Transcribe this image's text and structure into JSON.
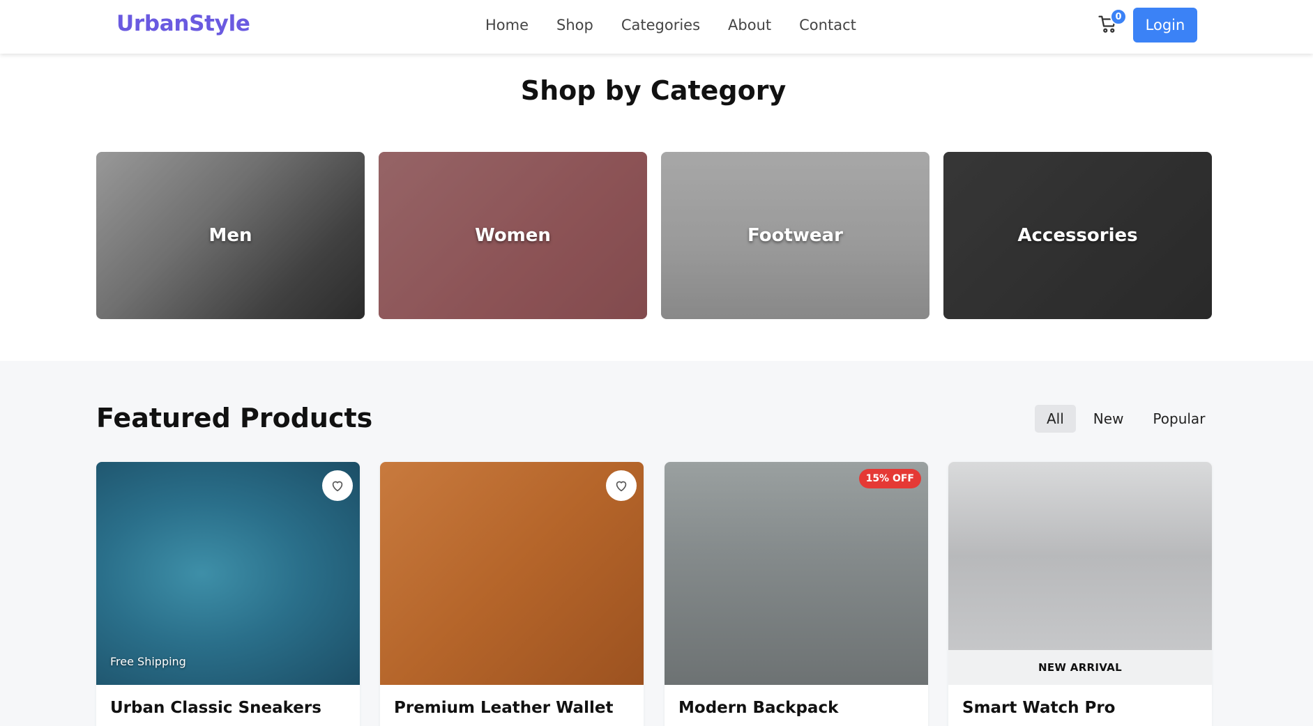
{
  "header": {
    "logo": "UrbanStyle",
    "nav": [
      "Home",
      "Shop",
      "Categories",
      "About",
      "Contact"
    ],
    "cart_count": "0",
    "login_label": "Login",
    "colors": {
      "accent": "#3b82f6",
      "logo": "#6a5ae0"
    }
  },
  "categories": {
    "title": "Shop by Category",
    "items": [
      {
        "label": "Men"
      },
      {
        "label": "Women"
      },
      {
        "label": "Footwear"
      },
      {
        "label": "Accessories"
      }
    ]
  },
  "featured": {
    "title": "Featured Products",
    "filters": [
      "All",
      "New",
      "Popular"
    ],
    "active_filter": "All",
    "products": [
      {
        "name": "Urban Classic Sneakers",
        "tag": "Free Shipping"
      },
      {
        "name": "Premium Leather Wallet"
      },
      {
        "name": "Modern Backpack",
        "badge": "15% OFF"
      },
      {
        "name": "Smart Watch Pro",
        "banner": "NEW ARRIVAL"
      }
    ]
  }
}
